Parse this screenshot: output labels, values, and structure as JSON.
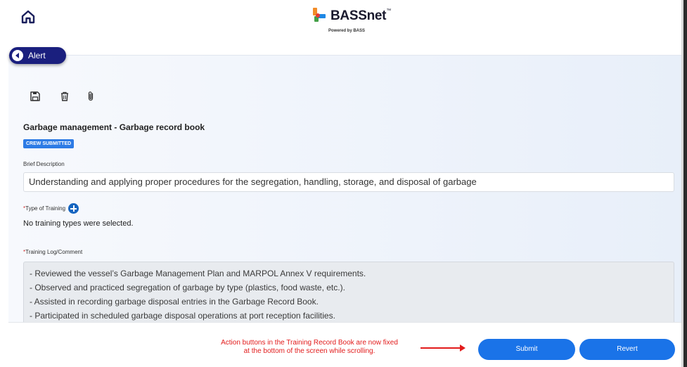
{
  "header": {
    "home_icon": "home-icon",
    "brand_name": "BASSnet",
    "brand_tm": "™",
    "brand_tagline": "Powered by BASS",
    "brand_colors": {
      "orange": "#f28c28",
      "blue": "#1e88e5",
      "green": "#43a047"
    }
  },
  "alert": {
    "label": "Alert",
    "icon": "chevron-left-icon"
  },
  "toolbar": {
    "icons": [
      "save-icon",
      "trash-icon",
      "paperclip-icon"
    ]
  },
  "record": {
    "title": "Garbage management - Garbage record book",
    "status": "CREW SUBMITTED",
    "status_color": "#2d7be5"
  },
  "brief_description": {
    "label": "Brief Description",
    "value": "Understanding and applying proper procedures for the segregation, handling, storage, and disposal of garbage"
  },
  "type_of_training": {
    "required_mark": "*",
    "label": "Type of Training",
    "empty_text": "No training types were selected."
  },
  "training_log": {
    "required_mark": "*",
    "label": "Training Log/Comment",
    "lines": [
      "- Reviewed the vessel’s Garbage Management Plan and MARPOL Annex V requirements.",
      "- Observed and practiced segregation of garbage by type (plastics, food waste, etc.).",
      "- Assisted in recording garbage disposal entries in the Garbage Record Book.",
      "- Participated in scheduled garbage disposal operations at port reception facilities."
    ]
  },
  "footer": {
    "note_line1": "Action buttons in the Training Record Book are now fixed",
    "note_line2": "at the bottom of the screen while scrolling.",
    "note_color": "#e21b1b",
    "submit_label": "Submit",
    "revert_label": "Revert",
    "button_color": "#1a73e8"
  }
}
